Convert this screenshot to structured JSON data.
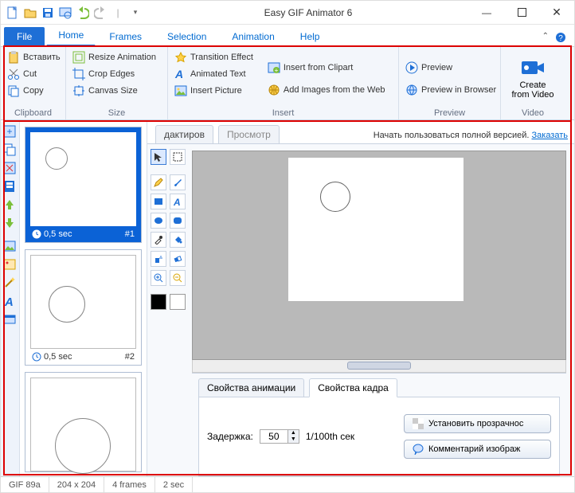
{
  "titlebar": {
    "title": "Easy GIF Animator 6"
  },
  "menu": {
    "file": "File",
    "tabs": [
      "Home",
      "Frames",
      "Selection",
      "Animation",
      "Help"
    ]
  },
  "ribbon": {
    "clipboard": {
      "label": "Clipboard",
      "paste": "Вставить",
      "cut": "Cut",
      "copy": "Copy"
    },
    "size": {
      "label": "Size",
      "resize": "Resize Animation",
      "crop": "Crop Edges",
      "canvas": "Canvas Size"
    },
    "insert": {
      "label": "Insert",
      "transition": "Transition Effect",
      "animated_text": "Animated Text",
      "insert_picture": "Insert Picture",
      "from_clipart": "Insert from Clipart",
      "from_web": "Add Images from the Web"
    },
    "preview": {
      "label": "Preview",
      "preview": "Preview",
      "in_browser": "Preview in Browser"
    },
    "video": {
      "label": "Video",
      "create": "Create",
      "from_video": "from Video"
    }
  },
  "editor_tabs": {
    "edit": "дактиров",
    "preview": "Просмотр"
  },
  "trial": {
    "msg": "Начать пользоваться полной версией. ",
    "link": "Заказать"
  },
  "frames": [
    {
      "delay": "0,5 sec",
      "index": "#1"
    },
    {
      "delay": "0,5 sec",
      "index": "#2"
    }
  ],
  "props": {
    "tab_anim": "Свойства анимации",
    "tab_frame": "Свойства кадра",
    "delay_label": "Задержка:",
    "delay_value": "50",
    "delay_unit": "1/100th сек",
    "transparent_btn": "Установить прозрачнос",
    "comment_btn": "Комментарий изображ"
  },
  "status": {
    "format": "GIF 89a",
    "dims": "204 x 204",
    "frames": "4 frames",
    "duration": "2 sec"
  }
}
